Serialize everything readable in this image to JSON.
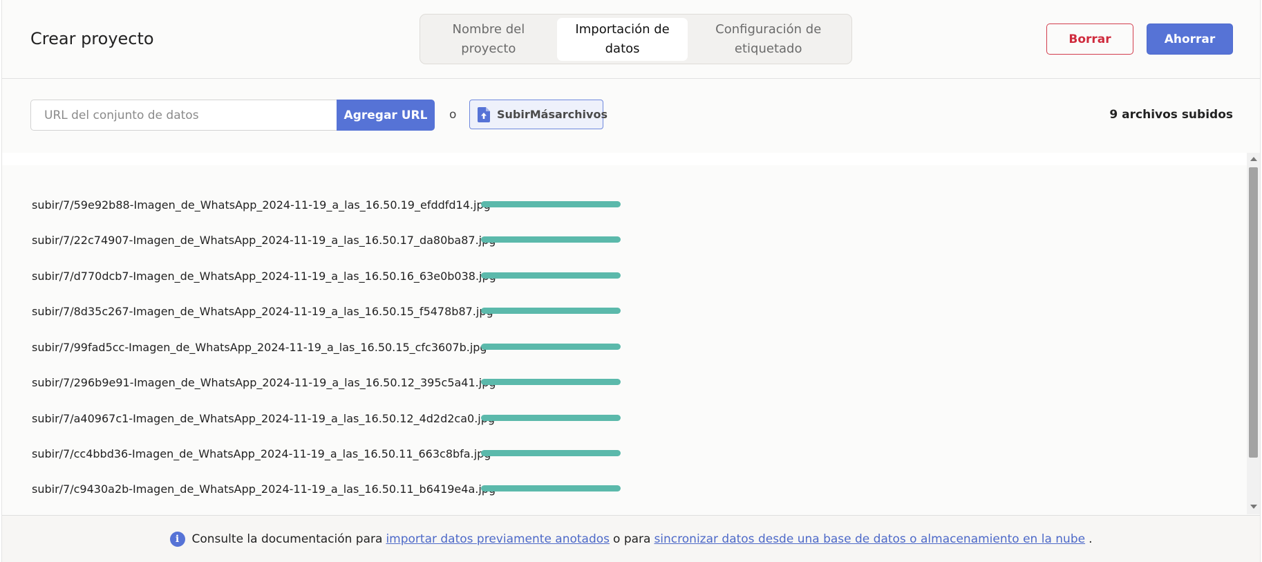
{
  "header": {
    "title": "Crear proyecto",
    "tabs": [
      {
        "label_line1": "Nombre del",
        "label_line2": "proyecto",
        "active": false
      },
      {
        "label_line1": "Importación de",
        "label_line2": "datos",
        "active": true
      },
      {
        "label_line1": "Configuración de",
        "label_line2": "etiquetado",
        "active": false
      }
    ],
    "clear_label": "Borrar",
    "save_label": "Ahorrar"
  },
  "toolbar": {
    "url_placeholder": "URL del conjunto de datos",
    "add_url_label": "Agregar URL",
    "or_text": "o",
    "upload_label": "SubirMásarchivos",
    "uploaded_count": "9 archivos subidos"
  },
  "files": [
    {
      "name": "subir/7/59e92b88-Imagen_de_WhatsApp_2024-11-19_a_las_16.50.19_efddfd14.jpg",
      "progress": 1.0
    },
    {
      "name": "subir/7/22c74907-Imagen_de_WhatsApp_2024-11-19_a_las_16.50.17_da80ba87.jpg",
      "progress": 1.0
    },
    {
      "name": "subir/7/d770dcb7-Imagen_de_WhatsApp_2024-11-19_a_las_16.50.16_63e0b038.jpg",
      "progress": 1.0
    },
    {
      "name": "subir/7/8d35c267-Imagen_de_WhatsApp_2024-11-19_a_las_16.50.15_f5478b87.jpg",
      "progress": 1.0
    },
    {
      "name": "subir/7/99fad5cc-Imagen_de_WhatsApp_2024-11-19_a_las_16.50.15_cfc3607b.jpg",
      "progress": 1.0
    },
    {
      "name": "subir/7/296b9e91-Imagen_de_WhatsApp_2024-11-19_a_las_16.50.12_395c5a41.jpg",
      "progress": 1.0
    },
    {
      "name": "subir/7/a40967c1-Imagen_de_WhatsApp_2024-11-19_a_las_16.50.12_4d2d2ca0.jpg",
      "progress": 1.0
    },
    {
      "name": "subir/7/cc4bbd36-Imagen_de_WhatsApp_2024-11-19_a_las_16.50.11_663c8bfa.jpg",
      "progress": 1.0
    },
    {
      "name": "subir/7/c9430a2b-Imagen_de_WhatsApp_2024-11-19_a_las_16.50.11_b6419e4a.jpg",
      "progress": 1.0
    }
  ],
  "footer": {
    "text_before": "Consulte la documentación para",
    "link1": "importar datos previamente anotados",
    "text_middle": "o para",
    "link2": "sincronizar datos desde una base de datos o almacenamiento en la nube",
    "text_after": "."
  },
  "colors": {
    "accent": "#5673d6",
    "danger": "#cf2b3d",
    "progress": "#5bb9ab"
  },
  "icons": {
    "upload": "file-upload-icon",
    "info": "info-icon"
  }
}
